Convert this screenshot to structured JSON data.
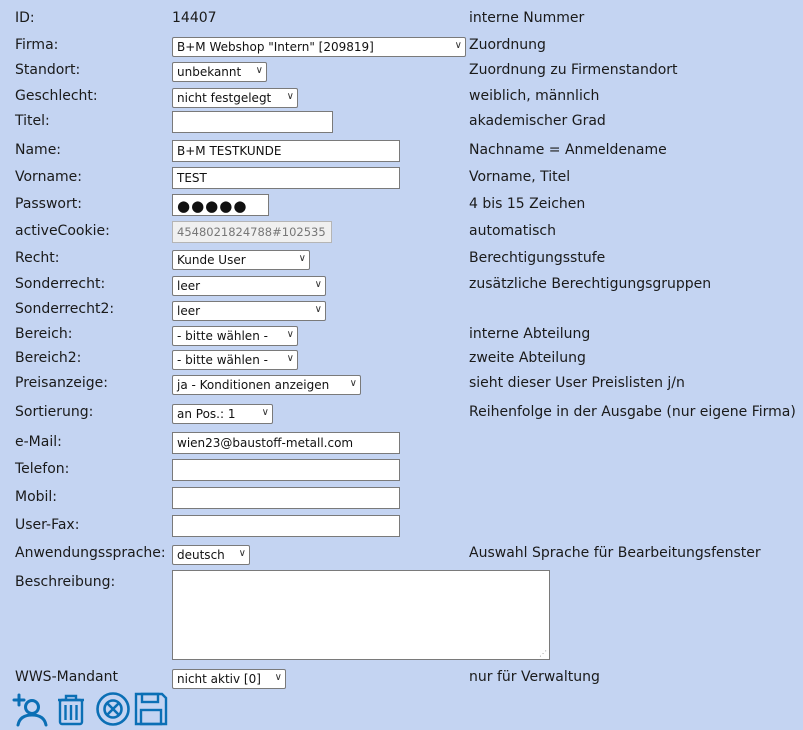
{
  "rows": [
    {
      "label": "ID:",
      "value": "14407",
      "desc": "interne Nummer"
    },
    {
      "label": "Firma:",
      "value": "B+M Webshop \"Intern\" [209819]",
      "desc": "Zuordnung"
    },
    {
      "label": "Standort:",
      "value": "unbekannt",
      "desc": "Zuordnung zu Firmenstandort"
    },
    {
      "label": "Geschlecht:",
      "value": "nicht festgelegt",
      "desc": "weiblich, männlich"
    },
    {
      "label": "Titel:",
      "value": "",
      "desc": "akademischer Grad"
    },
    {
      "label": "Name:",
      "value": "B+M TESTKUNDE",
      "desc": "Nachname = Anmeldename"
    },
    {
      "label": "Vorname:",
      "value": "TEST",
      "desc": "Vorname, Titel"
    },
    {
      "label": "Passwort:",
      "value": "●●●●●",
      "desc": "4 bis 15 Zeichen"
    },
    {
      "label": "activeCookie:",
      "value": "4548021824788#102535",
      "desc": "automatisch"
    },
    {
      "label": "Recht:",
      "value": "Kunde User",
      "desc": "Berechtigungsstufe"
    },
    {
      "label": "Sonderrecht:",
      "value": "leer",
      "desc": "zusätzliche Berechtigungsgruppen"
    },
    {
      "label": "Sonderrecht2:",
      "value": "leer",
      "desc": ""
    },
    {
      "label": "Bereich:",
      "value": "- bitte wählen -",
      "desc": "interne Abteilung"
    },
    {
      "label": "Bereich2:",
      "value": "- bitte wählen -",
      "desc": "zweite Abteilung"
    },
    {
      "label": "Preisanzeige:",
      "value": "ja - Konditionen anzeigen",
      "desc": "sieht dieser User Preislisten j/n"
    },
    {
      "label": "Sortierung:",
      "value": "an Pos.: 1",
      "desc": "Reihenfolge in der Ausgabe (nur eigene Firma)"
    },
    {
      "label": "e-Mail:",
      "value": "wien23@baustoff-metall.com",
      "desc": ""
    },
    {
      "label": "Telefon:",
      "value": "",
      "desc": ""
    },
    {
      "label": "Mobil:",
      "value": "",
      "desc": ""
    },
    {
      "label": "User-Fax:",
      "value": "",
      "desc": ""
    },
    {
      "label": "Anwendungssprache:",
      "value": "deutsch",
      "desc": "Auswahl Sprache für Bearbeitungsfenster"
    },
    {
      "label": "Beschreibung:",
      "value": "",
      "desc": ""
    },
    {
      "label": "WWS-Mandant",
      "value": "nicht aktiv [0]",
      "desc": "nur für Verwaltung"
    }
  ],
  "toolbar": {
    "icons": [
      "add-user-icon",
      "trash-icon",
      "cancel-icon",
      "save-icon"
    ],
    "accent_color": "#0b6fb5"
  },
  "colors": {
    "background": "#c4d4f2",
    "text": "#1a1a1a"
  }
}
